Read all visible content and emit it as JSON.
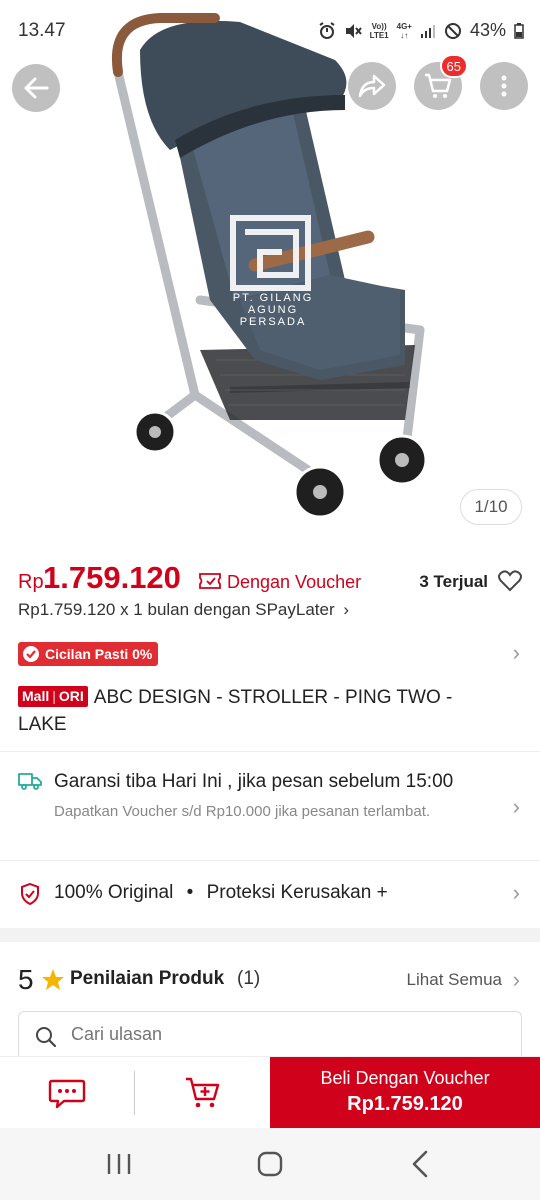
{
  "status_bar": {
    "time": "13.47",
    "volte": "Vo))",
    "lte": "LTE1",
    "net": "4G+",
    "battery": "43%"
  },
  "gallery": {
    "counter": "1/10",
    "cart_badge": "65",
    "watermark_line1": "PT. GILANG",
    "watermark_line2": "AGUNG",
    "watermark_line3": "PERSADA"
  },
  "price": {
    "currency": "Rp",
    "value": "1.759.120",
    "voucher_label": "Dengan Voucher",
    "sold": "3 Terjual",
    "spaylater": "Rp1.759.120 x 1 bulan dengan SPayLater"
  },
  "cicilan_label": "Cicilan Pasti 0%",
  "product": {
    "mall_label": "Mall",
    "ori_label": "ORI",
    "title": "ABC DESIGN - STROLLER - PING TWO - LAKE"
  },
  "shipping": {
    "title": "Garansi tiba Hari Ini , jika pesan sebelum 15:00",
    "subtitle": "Dapatkan Voucher s/d Rp10.000 jika pesanan terlambat."
  },
  "assurance": {
    "original": "100% Original",
    "dot": "•",
    "protection": "Proteksi Kerusakan +"
  },
  "rating": {
    "score": "5",
    "title": "Penilaian Produk",
    "count": "(1)",
    "see_all": "Lihat Semua"
  },
  "review_search": {
    "placeholder": "Cari ulasan"
  },
  "bottom_bar": {
    "buy_line1": "Beli Dengan Voucher",
    "buy_line2": "Rp1.759.120"
  },
  "colors": {
    "brand_red": "#d0011b",
    "teal": "#26aa99"
  }
}
